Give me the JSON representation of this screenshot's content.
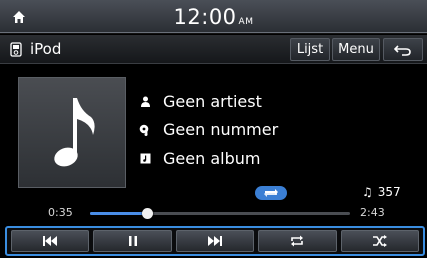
{
  "status_bar": {
    "time": "12:00",
    "ampm": "AM"
  },
  "toolbar": {
    "source_label": "iPod",
    "list_label": "Lijst",
    "menu_label": "Menu"
  },
  "track": {
    "artist": "Geen artiest",
    "title": "Geen nummer",
    "album": "Geen album"
  },
  "track_count": "357",
  "progress": {
    "elapsed": "0:35",
    "total": "2:43",
    "fraction": 0.22
  },
  "colors": {
    "accent": "#3a8de0",
    "progress_fill": "#4a8ee8",
    "repeat_indicator": "#3b7fd4"
  },
  "icons": {
    "home": "home-icon",
    "source": "ipod-icon",
    "back": "back-arrow-icon",
    "album_art": "music-note-icon",
    "artist": "person-icon",
    "title": "song-icon",
    "album": "album-icon",
    "repeat_indicator": "repeat-indicator-icon",
    "count": "music-note-icon",
    "prev": "previous-track-icon",
    "pause": "pause-icon",
    "next": "next-track-icon",
    "repeat": "repeat-icon",
    "shuffle": "shuffle-icon"
  }
}
